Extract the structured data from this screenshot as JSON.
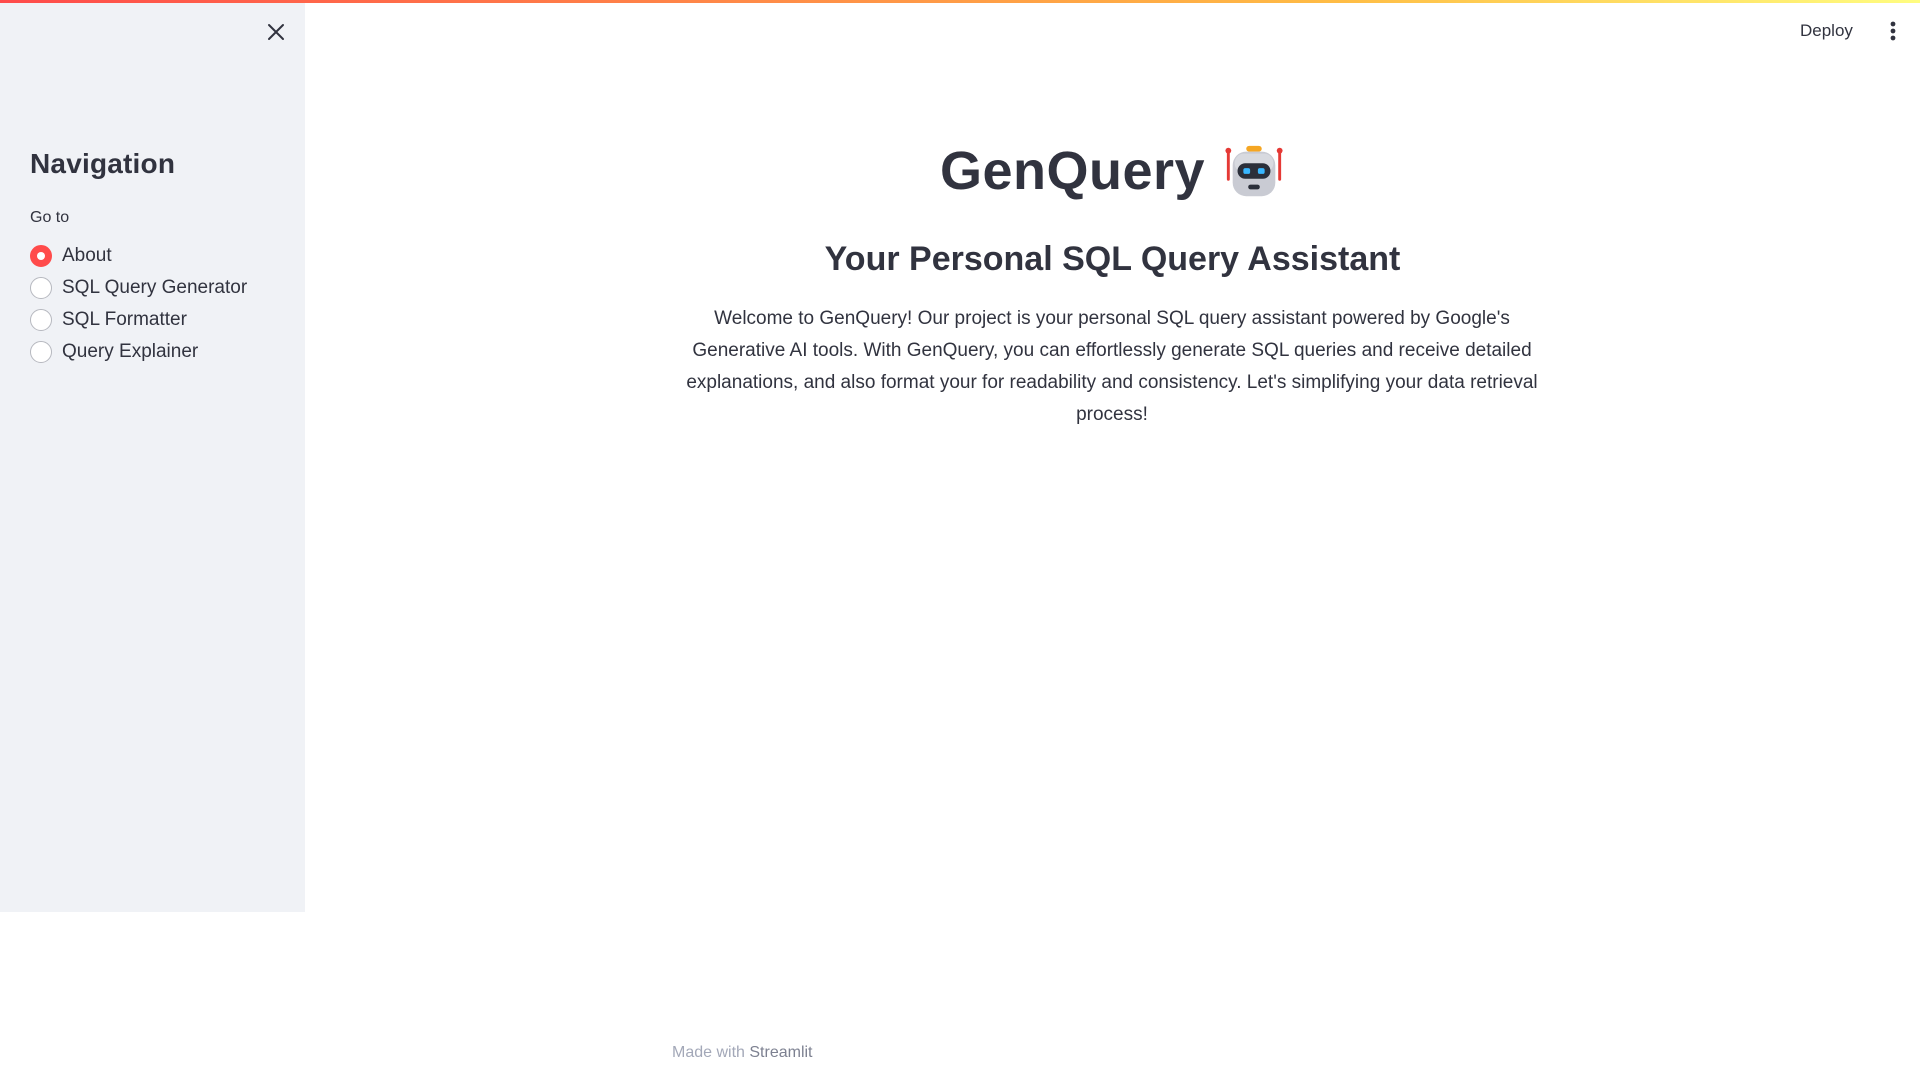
{
  "header": {
    "deploy_label": "Deploy",
    "menu_icon": "kebab-menu-icon"
  },
  "sidebar": {
    "close_icon": "close-icon",
    "title": "Navigation",
    "group_label": "Go to",
    "items": [
      {
        "label": "About",
        "selected": true
      },
      {
        "label": "SQL Query Generator",
        "selected": false
      },
      {
        "label": "SQL Formatter",
        "selected": false
      },
      {
        "label": "Query Explainer",
        "selected": false
      }
    ]
  },
  "main": {
    "title": "GenQuery",
    "title_icon": "robot-icon",
    "subtitle": "Your Personal SQL Query Assistant",
    "intro": "Welcome to GenQuery! Our project is your personal SQL query assistant powered by Google's Generative AI tools. With GenQuery, you can effortlessly generate SQL queries and receive detailed explanations, and also format your for readability and consistency. Let's simplifying your data retrieval process!"
  },
  "footer": {
    "prefix": "Made with",
    "brand": "Streamlit"
  },
  "colors": {
    "accent": "#ff4b4b",
    "sidebar_bg": "#f0f2f6",
    "text": "#31333f"
  }
}
